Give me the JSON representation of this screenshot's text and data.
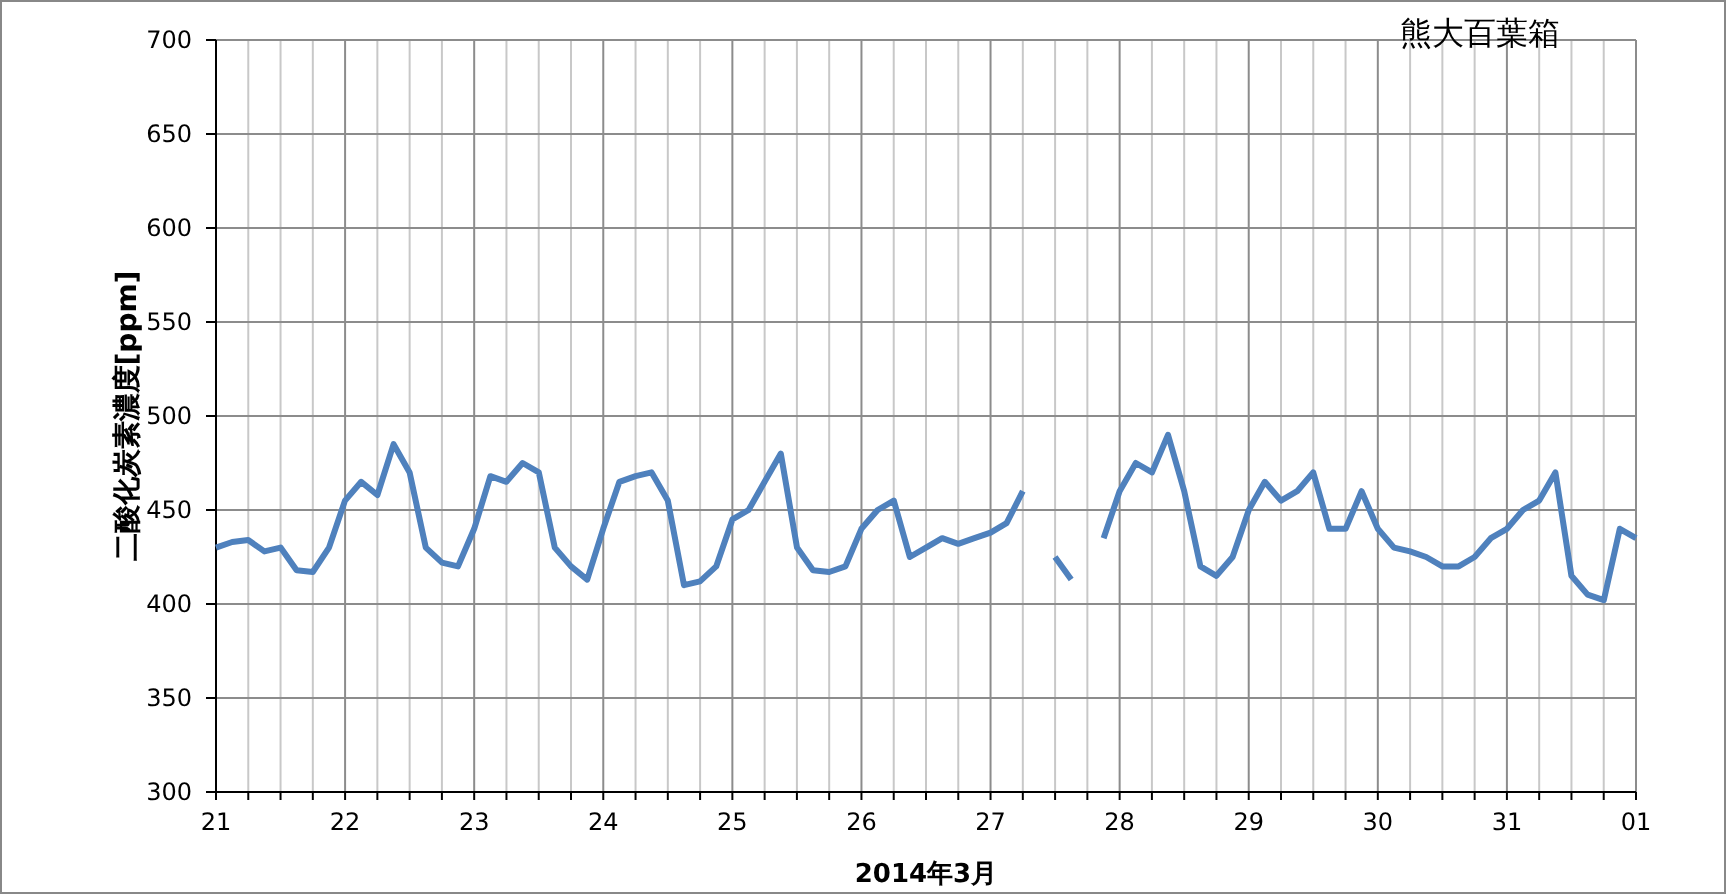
{
  "chart": {
    "chart_data": {
      "type": "line",
      "title": "熊大百葉箱",
      "xlabel": "2014年3月",
      "ylabel": "二酸化炭素濃度[ppm]",
      "categories": [
        "21",
        null,
        null,
        null,
        null,
        null,
        null,
        null,
        "22",
        null,
        null,
        null,
        null,
        null,
        null,
        null,
        "23",
        null,
        null,
        null,
        null,
        null,
        null,
        null,
        "24",
        null,
        null,
        null,
        null,
        null,
        null,
        null,
        "25",
        null,
        null,
        null,
        null,
        null,
        null,
        null,
        "26",
        null,
        null,
        null,
        null,
        null,
        null,
        null,
        "27",
        null,
        null,
        null,
        null,
        null,
        null,
        null,
        "28",
        null,
        null,
        null,
        null,
        null,
        null,
        null,
        "29",
        null,
        null,
        null,
        null,
        null,
        null,
        null,
        "30",
        null,
        null,
        null,
        null,
        null,
        null,
        null,
        "31",
        null,
        null,
        null,
        null,
        null,
        null,
        null,
        "01"
      ],
      "series": [
        {
          "color": "#4f81bd",
          "values": [
            430,
            433,
            434,
            428,
            430,
            418,
            417,
            430,
            455,
            465,
            458,
            485,
            470,
            430,
            422,
            420,
            440,
            468,
            465,
            475,
            470,
            430,
            420,
            413,
            440,
            465,
            468,
            470,
            455,
            410,
            412,
            420,
            445,
            450,
            465,
            480,
            430,
            418,
            417,
            420,
            440,
            450,
            455,
            425,
            430,
            435,
            432,
            435,
            438,
            443,
            460,
            null,
            425,
            413,
            null,
            435,
            460,
            475,
            470,
            490,
            460,
            420,
            415,
            425,
            450,
            465,
            455,
            460,
            470,
            440,
            440,
            460,
            440,
            430,
            428,
            425,
            420,
            420,
            425,
            435,
            440,
            450,
            455,
            470,
            415,
            405,
            402,
            440,
            435
          ]
        }
      ],
      "ylim": [
        300,
        700
      ],
      "grid": true,
      "yticks": [
        300,
        350,
        400,
        450,
        500,
        550,
        600,
        650,
        700
      ]
    }
  }
}
